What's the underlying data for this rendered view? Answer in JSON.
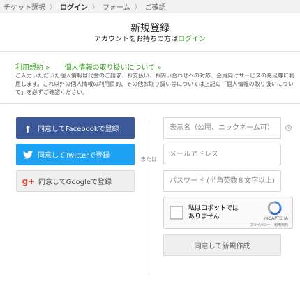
{
  "breadcrumb": {
    "items": [
      "チケット選択",
      "ログイン",
      "フォーム",
      "ご確認"
    ],
    "separator": "〉"
  },
  "header": {
    "title": "新規登録",
    "subtitle_prefix": "アカウントをお持ちの方は",
    "login_link": "ログイン"
  },
  "terms": {
    "link1": "利用規約 »",
    "link2": "個人情報の取り扱いについて »",
    "notice": "ご入力いただいた個人情報は代金のご請求、お支払い、お問い合わせへの対応、会員向けサービスの充足等に利用します。これ以外の個人情報の利用目的、その他お取り扱い等については上記の「個人情報の取り扱いについて」を必ずご確認ください。"
  },
  "social": {
    "facebook": "同意してFacebookで登録",
    "twitter": "同意してTwitterで登録",
    "google": "同意してGoogleで登録",
    "facebook_icon": "f",
    "google_icon": "g+"
  },
  "divider": "または",
  "form": {
    "display_name_placeholder": "表示名（公開、ニックネーム可）",
    "email_placeholder": "メールアドレス",
    "password_placeholder": "パスワード (半角英数８文字以上)",
    "help_icon": "?",
    "submit": "同意して新規作成"
  },
  "captcha": {
    "label": "私はロボットではありません",
    "brand": "reCAPTCHA",
    "links": "プライバシー - 利用規約"
  },
  "colors": {
    "accent": "#3a9d23",
    "facebook": "#3b5998",
    "twitter": "#1da1f2",
    "google": "#dd4b39"
  }
}
